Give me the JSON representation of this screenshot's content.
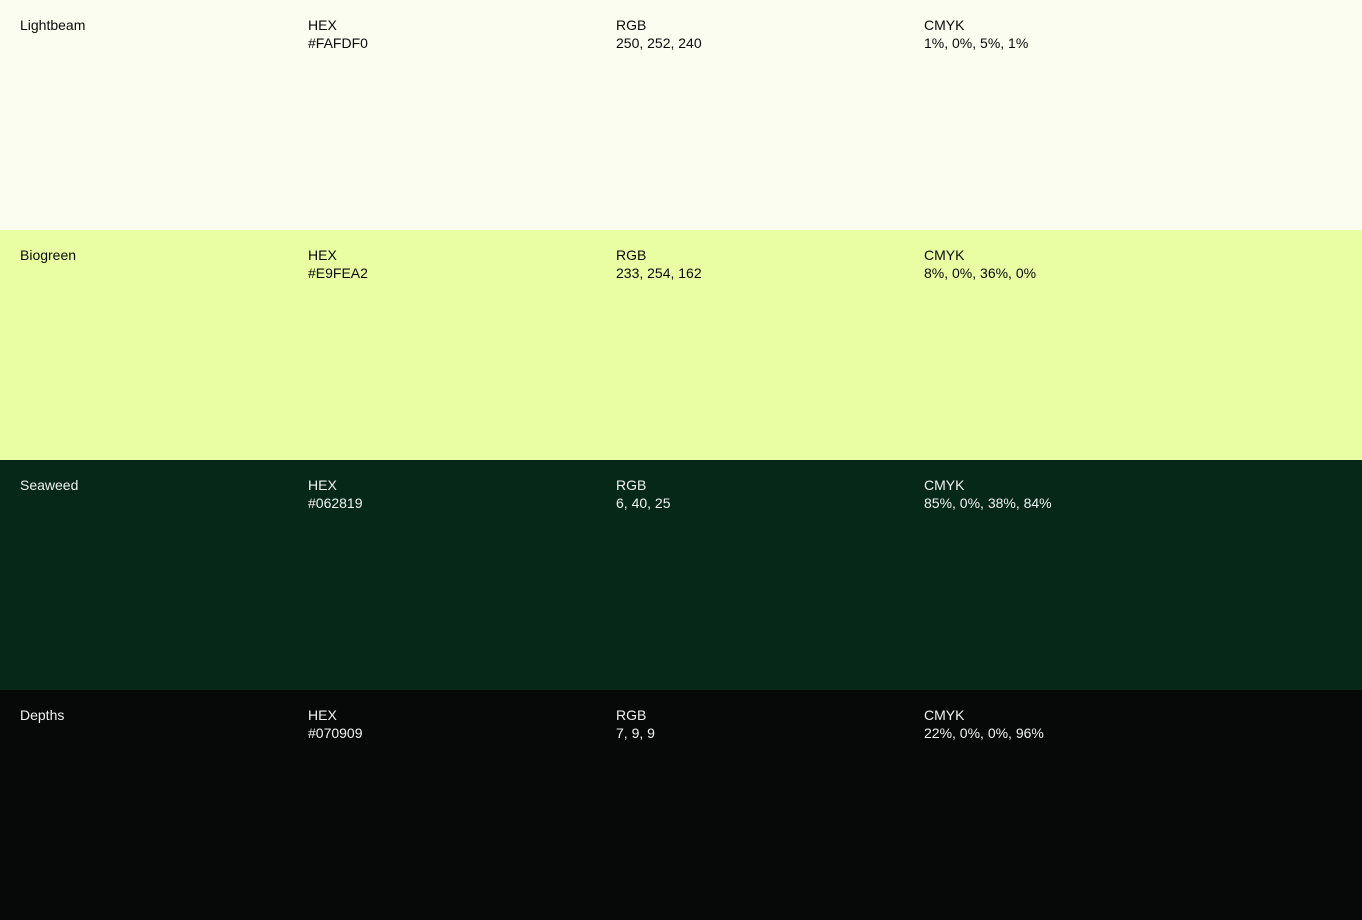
{
  "labels": {
    "hex": "HEX",
    "rgb": "RGB",
    "cmyk": "CMYK"
  },
  "swatches": [
    {
      "name": "Lightbeam",
      "hex": "#FAFDF0",
      "rgb": "250, 252, 240",
      "cmyk": "1%, 0%, 5%, 1%",
      "background": "#FAFDF0",
      "text_color": "#0a0a0a"
    },
    {
      "name": "Biogreen",
      "hex": "#E9FEA2",
      "rgb": "233, 254, 162",
      "cmyk": "8%, 0%, 36%, 0%",
      "background": "#E9FEA2",
      "text_color": "#0a0a0a"
    },
    {
      "name": "Seaweed",
      "hex": "#062819",
      "rgb": "6, 40, 25",
      "cmyk": "85%, 0%, 38%, 84%",
      "background": "#062819",
      "text_color": "#f2f2f2"
    },
    {
      "name": "Depths",
      "hex": "#070909",
      "rgb": "7, 9, 9",
      "cmyk": "22%, 0%, 0%, 96%",
      "background": "#070909",
      "text_color": "#f2f2f2"
    }
  ]
}
